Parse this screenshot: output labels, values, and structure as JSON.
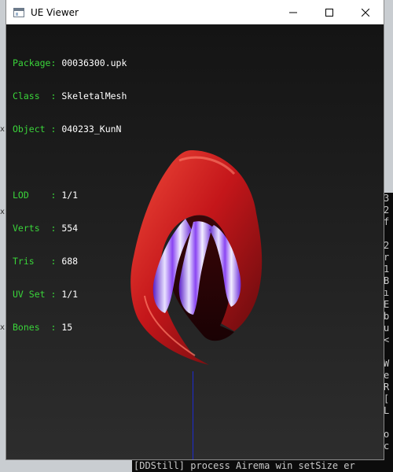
{
  "window": {
    "title": "UE Viewer",
    "icons": {
      "app": "window-app-icon",
      "minimize": "minimize-icon",
      "maximize": "maximize-icon",
      "close": "close-icon"
    }
  },
  "info": {
    "package_key": "Package: ",
    "package_value": "00036300.upk",
    "class_key": "Class  : ",
    "class_value": "SkeletalMesh",
    "object_key": "Object : ",
    "object_value": "040233_KunN",
    "lod_key": "LOD    : ",
    "lod_value": "1/1",
    "verts_key": "Verts  : ",
    "verts_value": "554",
    "tris_key": "Tris   : ",
    "tris_value": "688",
    "uvset_key": "UV Set : ",
    "uvset_value": "1/1",
    "bones_key": "Bones  : ",
    "bones_value": "15"
  },
  "background": {
    "console_lines": [
      "3",
      "2",
      "f",
      "",
      "2",
      "r",
      "1",
      "B",
      "ı",
      "E",
      "b",
      "u",
      "<",
      "",
      "W",
      "e",
      "R",
      "[",
      "L",
      "",
      "o",
      "c"
    ],
    "bottom_line": "[DDStill] process  Airema win setSize  er",
    "desktop_marks": [
      "x",
      "x",
      "x"
    ]
  },
  "colors": {
    "label_green": "#3ad43a",
    "value_white": "#ffffff",
    "axis_blue": "#1d2bd0",
    "hood_red": "#d41f1f",
    "hair_purple": "#7a3cf0"
  }
}
